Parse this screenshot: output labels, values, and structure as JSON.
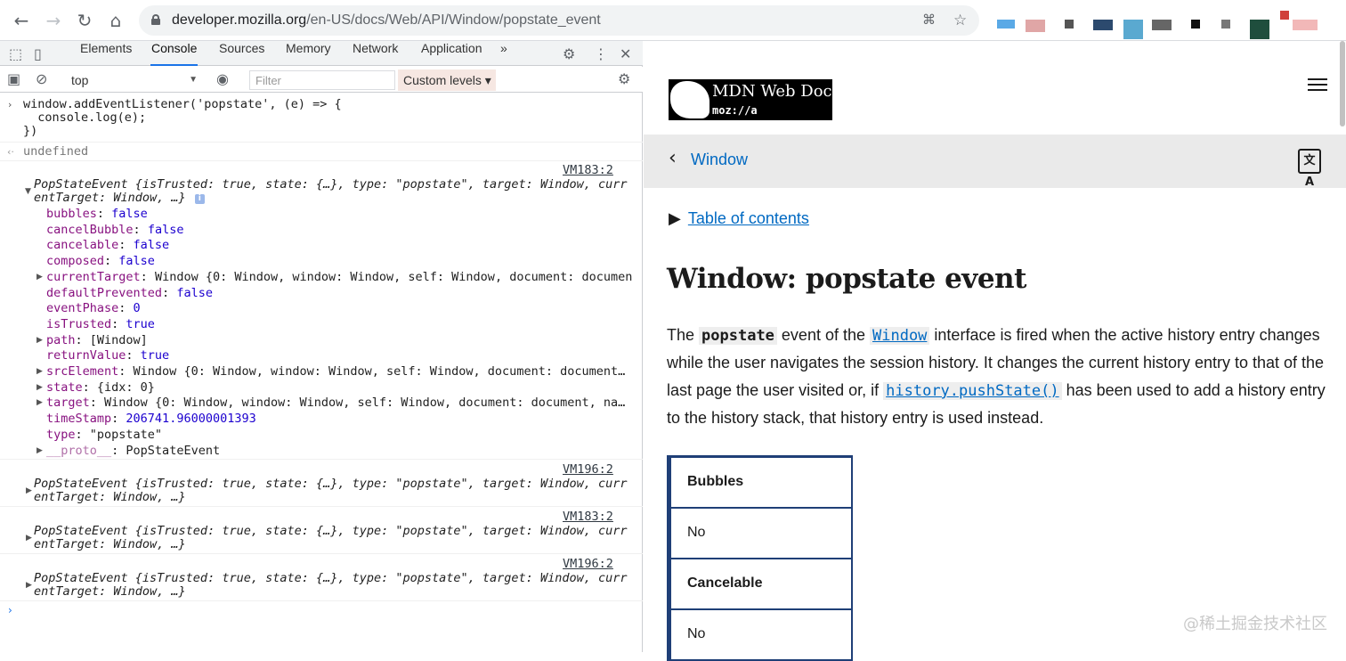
{
  "browser": {
    "url_host": "developer.mozilla.org",
    "url_path": "/en-US/docs/Web/API/Window/popstate_event"
  },
  "devtools": {
    "tabs": [
      "Elements",
      "Console",
      "Sources",
      "Memory",
      "Network",
      "Application"
    ],
    "active_tab": "Console",
    "more_tabs": "»",
    "context": "top",
    "filter_placeholder": "Filter",
    "levels_label": "Custom levels ▾",
    "console": {
      "input_lines": [
        "window.addEventListener('popstate', (e) => {",
        "  console.log(e);",
        "})"
      ],
      "result": "undefined",
      "entries": [
        {
          "source": "VM183:2",
          "summary_1": "PopStateEvent {isTrusted: true, state: {…}, type: \"popstate\", target: Window, curr",
          "summary_2": "entTarget: Window, …}",
          "expanded": true,
          "props": [
            {
              "key": "bubbles",
              "value": "false",
              "expandable": false
            },
            {
              "key": "cancelBubble",
              "value": "false",
              "expandable": false
            },
            {
              "key": "cancelable",
              "value": "false",
              "expandable": false
            },
            {
              "key": "composed",
              "value": "false",
              "expandable": false
            },
            {
              "key": "currentTarget",
              "value": "Window {0: Window, window: Window, self: Window, document: documen",
              "expandable": true
            },
            {
              "key": "defaultPrevented",
              "value": "false",
              "expandable": false
            },
            {
              "key": "eventPhase",
              "value": "0",
              "expandable": false
            },
            {
              "key": "isTrusted",
              "value": "true",
              "expandable": false
            },
            {
              "key": "path",
              "value": "[Window]",
              "expandable": true
            },
            {
              "key": "returnValue",
              "value": "true",
              "expandable": false
            },
            {
              "key": "srcElement",
              "value": "Window {0: Window, window: Window, self: Window, document: document…",
              "expandable": true
            },
            {
              "key": "state",
              "value": "{idx: 0}",
              "expandable": true
            },
            {
              "key": "target",
              "value": "Window {0: Window, window: Window, self: Window, document: document, na…",
              "expandable": true
            },
            {
              "key": "timeStamp",
              "value": "206741.96000001393",
              "expandable": false
            },
            {
              "key": "type",
              "value": "\"popstate\"",
              "expandable": false
            },
            {
              "key": "__proto__",
              "value": "PopStateEvent",
              "expandable": true
            }
          ]
        },
        {
          "source": "VM196:2",
          "summary_1": "PopStateEvent {isTrusted: true, state: {…}, type: \"popstate\", target: Window, curr",
          "summary_2": "entTarget: Window, …}",
          "expanded": false
        },
        {
          "source": "VM183:2",
          "summary_1": "PopStateEvent {isTrusted: true, state: {…}, type: \"popstate\", target: Window, curr",
          "summary_2": "entTarget: Window, …}",
          "expanded": false
        },
        {
          "source": "VM196:2",
          "summary_1": "PopStateEvent {isTrusted: true, state: {…}, type: \"popstate\", target: Window, curr",
          "summary_2": "entTarget: Window, …}",
          "expanded": false
        }
      ]
    }
  },
  "page": {
    "logo_text": "MDN Web Docs",
    "logo_sub": "moz://a",
    "breadcrumb": "Window",
    "toc_label": "Table of contents",
    "title": "Window: popstate event",
    "para": {
      "t1": "The ",
      "code1": "popstate",
      "t2": " event of the ",
      "link1": "Window",
      "t3": " interface is fired when the active history entry changes while the user navigates the session history. It changes the current history entry to that of the last page the user visited or, if ",
      "link2": "history.pushState()",
      "t4": " has been used to add a history entry to the history stack, that history entry is used instead."
    },
    "table": [
      {
        "label": "Bubbles",
        "header": true
      },
      {
        "label": "No",
        "header": false
      },
      {
        "label": "Cancelable",
        "header": true
      },
      {
        "label": "No",
        "header": false
      }
    ],
    "watermark": "@稀土掘金技术社区"
  }
}
